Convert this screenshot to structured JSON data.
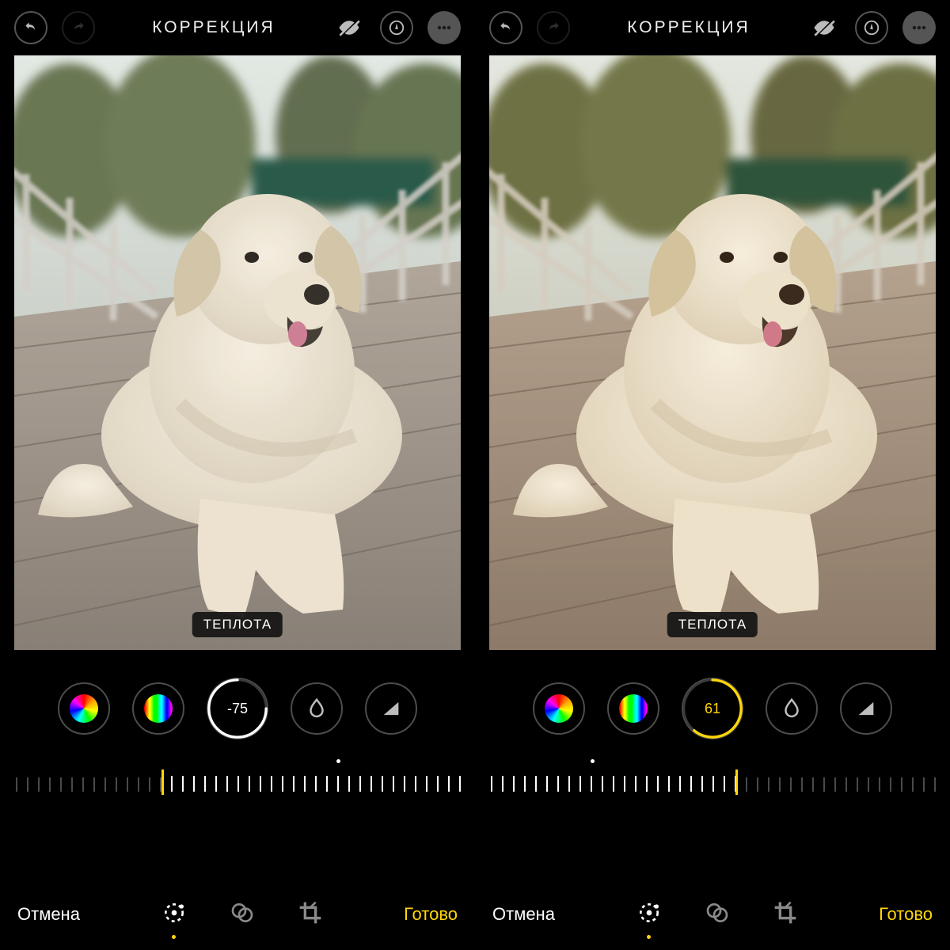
{
  "panes": [
    {
      "id": "left",
      "header": {
        "title": "КОРРЕКЦИЯ"
      },
      "badge": "ТЕПЛОТА",
      "photo_warmth_hue": "#eceff1",
      "photo_overlay_opacity": 0.23,
      "adjustment": {
        "value": "-75",
        "value_color": "white",
        "ring_arc_deg_start": -90,
        "ring_arc_deg_span": -270,
        "ring_color": "#ffffff",
        "needle_frac": 0.328,
        "dot_frac": 0.724
      },
      "footer": {
        "cancel": "Отмена",
        "done": "Готово",
        "active_mode": 0
      }
    },
    {
      "id": "right",
      "header": {
        "title": "КОРРЕКЦИЯ"
      },
      "badge": "ТЕПЛОТА",
      "photo_warmth_hue": "#ffb070",
      "photo_overlay_opacity": 0.28,
      "adjustment": {
        "value": "61",
        "value_color": "yellow",
        "ring_arc_deg_start": -90,
        "ring_arc_deg_span": 220,
        "ring_color": "#ffd60a",
        "needle_frac": 0.552,
        "dot_frac": 0.225
      },
      "footer": {
        "cancel": "Отмена",
        "done": "Готово",
        "active_mode": 0
      }
    }
  ],
  "tooldials": [
    {
      "name": "color-dial",
      "kind": "color"
    },
    {
      "name": "bw-dial",
      "kind": "bw"
    },
    {
      "name": "warmth-dial",
      "kind": "value"
    },
    {
      "name": "tint-dial",
      "kind": "drop"
    },
    {
      "name": "sharpness-dial",
      "kind": "triangle"
    }
  ],
  "modes": [
    {
      "name": "adjust-mode",
      "icon": "adjust"
    },
    {
      "name": "filters-mode",
      "icon": "filters"
    },
    {
      "name": "crop-mode",
      "icon": "crop"
    }
  ],
  "icons": {
    "undo": "undo",
    "redo": "redo",
    "eye-off": "eye-off",
    "markup": "markup",
    "more": "more"
  }
}
